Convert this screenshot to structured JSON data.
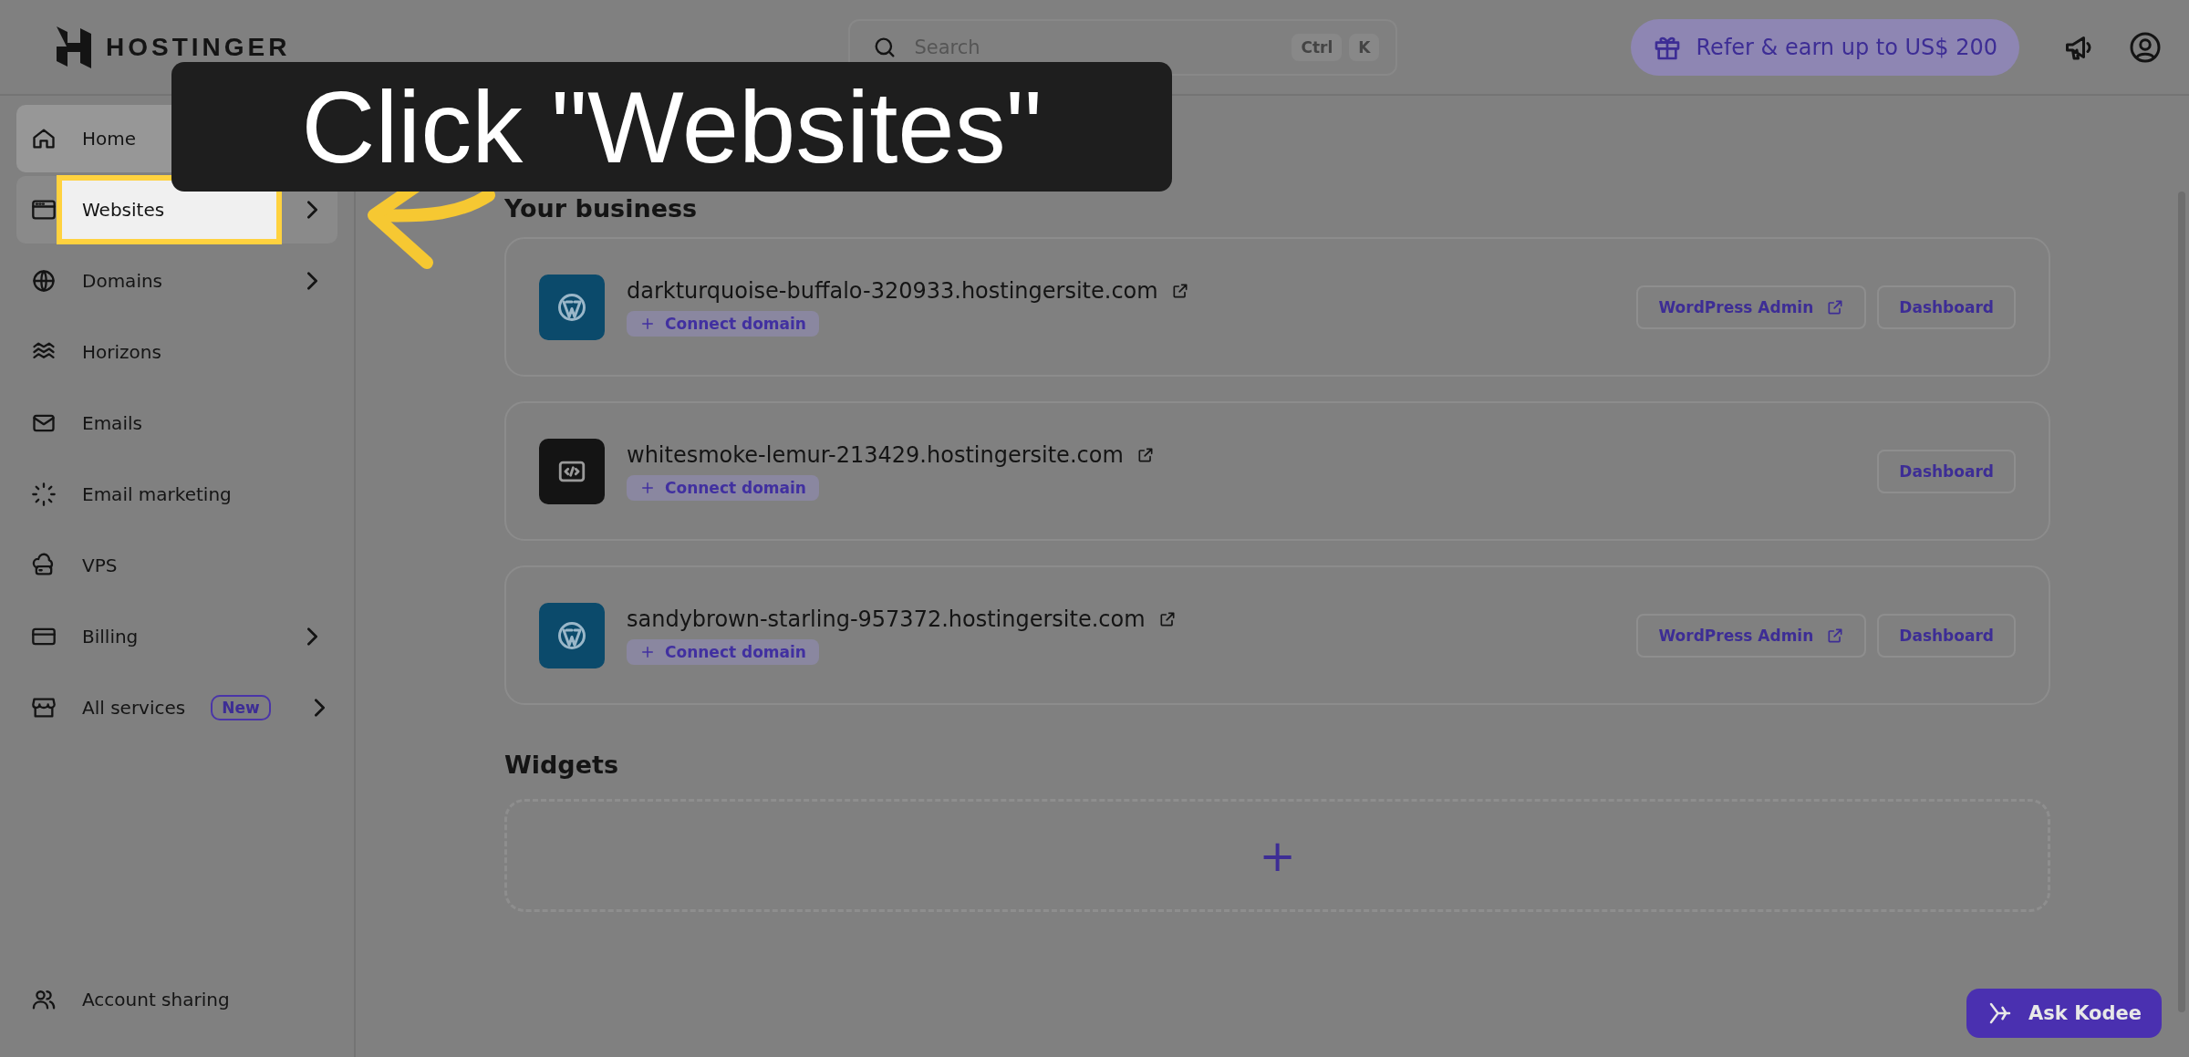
{
  "topbar": {
    "logo": "HOSTINGER",
    "search": {
      "placeholder": "Search",
      "shortcut": [
        "Ctrl",
        "K"
      ]
    },
    "refer": "Refer & earn up to US$ 200"
  },
  "sidebar": {
    "items": [
      {
        "label": "Home",
        "selected": true,
        "spotlight": false,
        "expandable": false
      },
      {
        "label": "Websites",
        "selected": false,
        "spotlight": true,
        "expandable": true
      },
      {
        "label": "Domains",
        "selected": false,
        "spotlight": false,
        "expandable": true
      },
      {
        "label": "Horizons",
        "selected": false,
        "spotlight": false,
        "expandable": false
      },
      {
        "label": "Emails",
        "selected": false,
        "spotlight": false,
        "expandable": false
      },
      {
        "label": "Email marketing",
        "selected": false,
        "spotlight": false,
        "expandable": false
      },
      {
        "label": "VPS",
        "selected": false,
        "spotlight": false,
        "expandable": false
      },
      {
        "label": "Billing",
        "selected": false,
        "spotlight": false,
        "expandable": true
      },
      {
        "label": "All services",
        "selected": false,
        "spotlight": false,
        "expandable": true,
        "badge": "New"
      }
    ],
    "footer_items": [
      {
        "label": "Account sharing",
        "selected": false,
        "spotlight": false,
        "expandable": false
      }
    ]
  },
  "main": {
    "section_title": "Your business",
    "sites": [
      {
        "kind": "wordpress",
        "domain": "darkturquoise-buffalo-320933.hostingersite.com",
        "connect": "Connect domain",
        "buttons": [
          {
            "label": "WordPress Admin",
            "external": true
          },
          {
            "label": "Dashboard",
            "external": false
          }
        ]
      },
      {
        "kind": "code",
        "domain": "whitesmoke-lemur-213429.hostingersite.com",
        "connect": "Connect domain",
        "buttons": [
          {
            "label": "Dashboard",
            "external": false
          }
        ]
      },
      {
        "kind": "wordpress",
        "domain": "sandybrown-starling-957372.hostingersite.com",
        "connect": "Connect domain",
        "buttons": [
          {
            "label": "WordPress Admin",
            "external": true
          },
          {
            "label": "Dashboard",
            "external": false
          }
        ]
      }
    ],
    "widgets": {
      "title": "Widgets",
      "add": "+"
    }
  },
  "assistant": {
    "label": "Ask Kodee"
  },
  "callout": {
    "text": "Click \"Websites\""
  }
}
